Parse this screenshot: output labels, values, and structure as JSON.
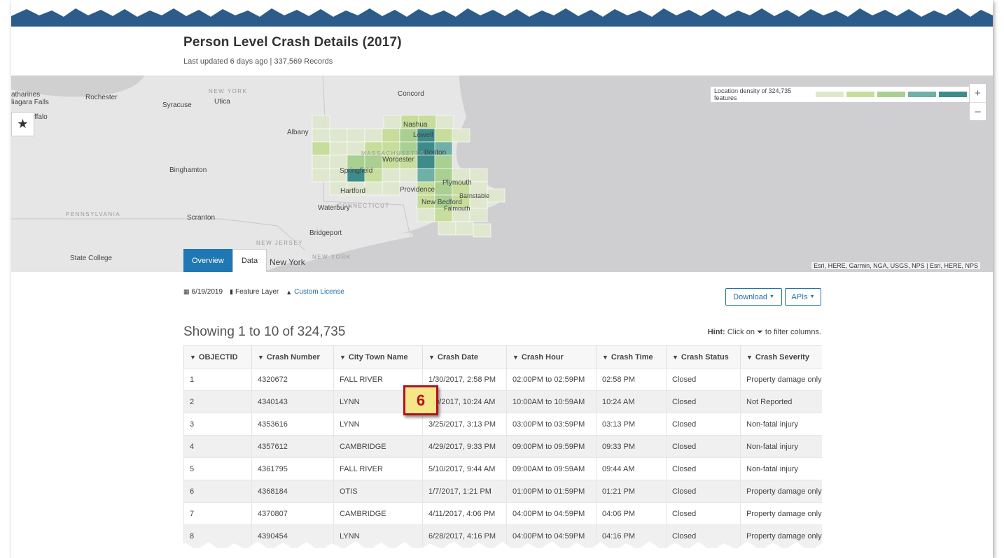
{
  "page": {
    "title": "Person Level Crash Details (2017)",
    "subtitle": "Last updated 6 days ago | 337,569 Records"
  },
  "map": {
    "legend_label": "Location density of 324,735 features",
    "legend_colors": [
      "#dfe8cf",
      "#c6dd9b",
      "#a9cf91",
      "#6fb0a7",
      "#3d8c8a"
    ],
    "attribution": "Esri, HERE, Garmin, NGA, USGS, NPS | Esri, HERE, NPS",
    "zoom_in": "+",
    "zoom_out": "–",
    "star_icon": "★",
    "places": {
      "catharines": "atharines",
      "niagara": "liagara Falls",
      "buffalo": "ffalo",
      "rochester": "Rochester",
      "syracuse": "Syracuse",
      "newyork_state": "NEW YORK",
      "utica": "Utica",
      "concord": "Concord",
      "albany": "Albany",
      "nashua": "Nashua",
      "lowell": "Lowell",
      "boston": "Boston",
      "worcester": "Worcester",
      "springfield": "Springfield",
      "binghamton": "Binghamton",
      "hartford": "Hartford",
      "providence": "Providence",
      "plymouth": "Plymouth",
      "barnstable": "Barnstable",
      "newbedford": "New Bedford",
      "falmouth": "Falmouth",
      "waterbury": "Waterbury",
      "connecticut": "CONNECTICUT",
      "massachusetts": "MASSACHUSETTS",
      "pennsylvania": "PENNSYLVANIA",
      "scranton": "Scranton",
      "bridgeport": "Bridgeport",
      "newjersey": "NEW JERSEY",
      "newyork_state2": "NEW YORK",
      "newyork_city": "New York",
      "statecollege": "State College"
    }
  },
  "tabs": [
    {
      "label": "Overview",
      "active": true
    },
    {
      "label": "Data",
      "active": false
    }
  ],
  "meta": {
    "date": "6/19/2019",
    "type": "Feature Layer",
    "license": "Custom License",
    "calendar_icon": "calendar-icon",
    "file_icon": "file-icon",
    "lock_icon": "lock-icon"
  },
  "buttons": {
    "download": "Download",
    "apis": "APIs"
  },
  "results": {
    "showing": "Showing 1 to 10 of 324,735",
    "hint_bold": "Hint:",
    "hint_pre": "Click on",
    "hint_post": "to filter columns."
  },
  "table": {
    "columns": [
      "OBJECTID",
      "Crash Number",
      "City Town Name",
      "Crash Date",
      "Crash Hour",
      "Crash Time",
      "Crash Status",
      "Crash Severity"
    ],
    "rows": [
      [
        "1",
        "4320672",
        "FALL RIVER",
        "1/30/2017, 2:58 PM",
        "02:00PM to 02:59PM",
        "02:58 PM",
        "Closed",
        "Property damage only"
      ],
      [
        "2",
        "4340143",
        "LYNN",
        "2/9/2017, 10:24 AM",
        "10:00AM to 10:59AM",
        "10:24 AM",
        "Closed",
        "Not Reported"
      ],
      [
        "3",
        "4353616",
        "LYNN",
        "3/25/2017, 3:13 PM",
        "03:00PM to 03:59PM",
        "03:13 PM",
        "Closed",
        "Non-fatal injury"
      ],
      [
        "4",
        "4357612",
        "CAMBRIDGE",
        "4/29/2017, 9:33 PM",
        "09:00PM to 09:59PM",
        "09:33 PM",
        "Closed",
        "Non-fatal injury"
      ],
      [
        "5",
        "4361795",
        "FALL RIVER",
        "5/10/2017, 9:44 AM",
        "09:00AM to 09:59AM",
        "09:44 AM",
        "Closed",
        "Non-fatal injury"
      ],
      [
        "6",
        "4368184",
        "OTIS",
        "1/7/2017, 1:21 PM",
        "01:00PM to 01:59PM",
        "01:21 PM",
        "Closed",
        "Property damage only"
      ],
      [
        "7",
        "4370807",
        "CAMBRIDGE",
        "4/11/2017, 4:06 PM",
        "04:00PM to 04:59PM",
        "04:06 PM",
        "Closed",
        "Property damage only"
      ],
      [
        "8",
        "4390454",
        "LYNN",
        "6/28/2017, 4:16 PM",
        "04:00PM to 04:59PM",
        "04:16 PM",
        "Closed",
        "Property damage only"
      ]
    ]
  },
  "callout": {
    "number": "6"
  }
}
